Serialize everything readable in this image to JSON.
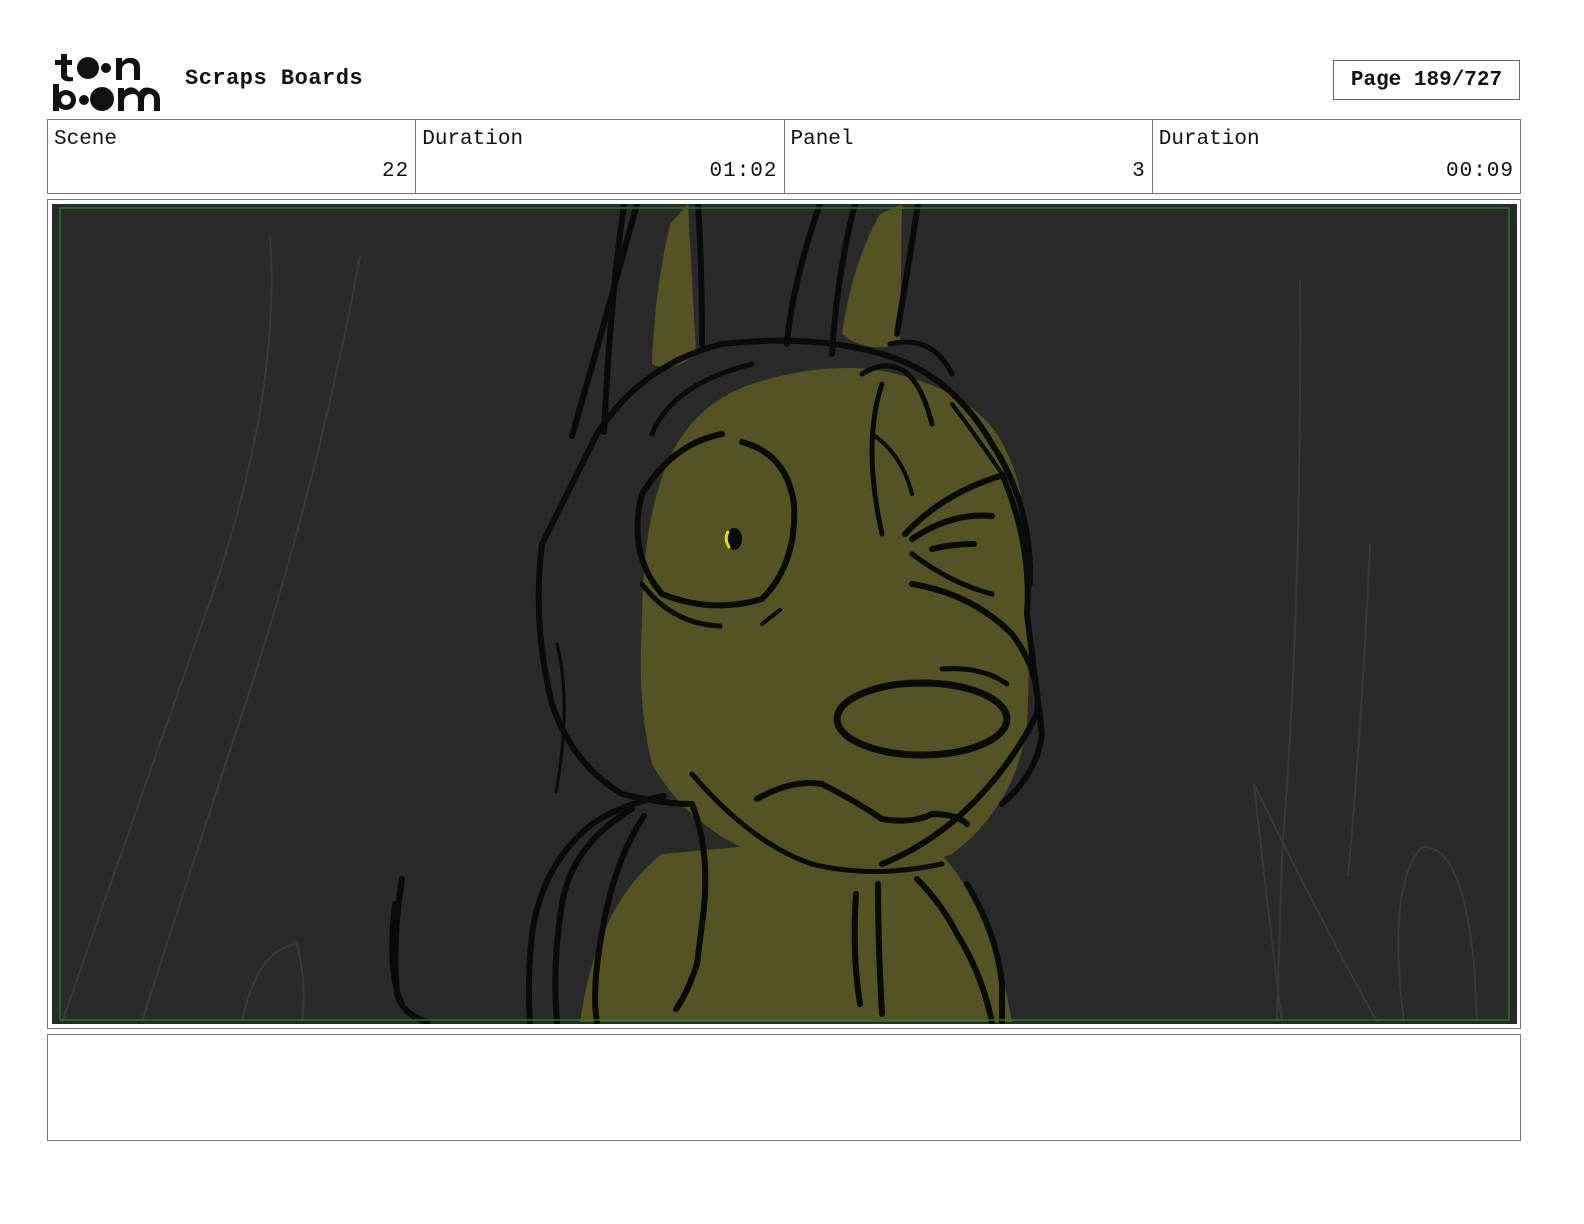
{
  "header": {
    "logo_text": "toon boom",
    "project_title": "Scraps Boards",
    "page_label": "Page 189/727"
  },
  "info": {
    "scene_label": "Scene",
    "scene_value": "22",
    "scene_duration_label": "Duration",
    "scene_duration_value": "01:02",
    "panel_label": "Panel",
    "panel_value": "3",
    "panel_duration_label": "Duration",
    "panel_duration_value": "00:09"
  },
  "panel_image": {
    "subject": "character-close-up-sketch",
    "background_color": "#2a2a2a",
    "fill_color": "#545323",
    "safe_area_color": "#1f7a1f",
    "eye_highlight_color": "#e8e000"
  },
  "notes": {
    "text": ""
  }
}
